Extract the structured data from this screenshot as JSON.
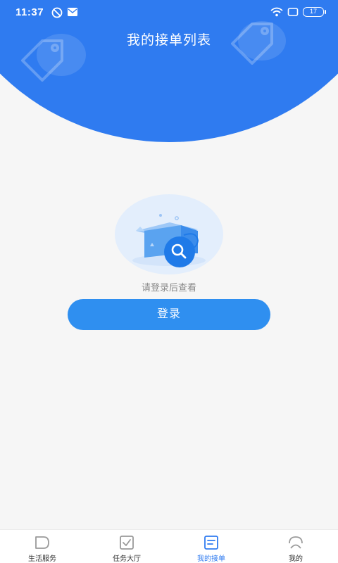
{
  "status_bar": {
    "time": "11:37",
    "battery": "17"
  },
  "header": {
    "title": "我的接单列表"
  },
  "empty_state": {
    "message": "请登录后查看",
    "login_label": "登录"
  },
  "tabbar": {
    "items": [
      {
        "label": "生活服务",
        "icon": "service-icon",
        "active": false
      },
      {
        "label": "任务大厅",
        "icon": "task-check-icon",
        "active": false
      },
      {
        "label": "我的接单",
        "icon": "orders-list-icon",
        "active": true
      },
      {
        "label": "我的",
        "icon": "profile-icon",
        "active": false
      }
    ]
  },
  "colors": {
    "primary": "#2f7bf0",
    "button": "#2f8ff0",
    "background": "#f6f6f6"
  }
}
